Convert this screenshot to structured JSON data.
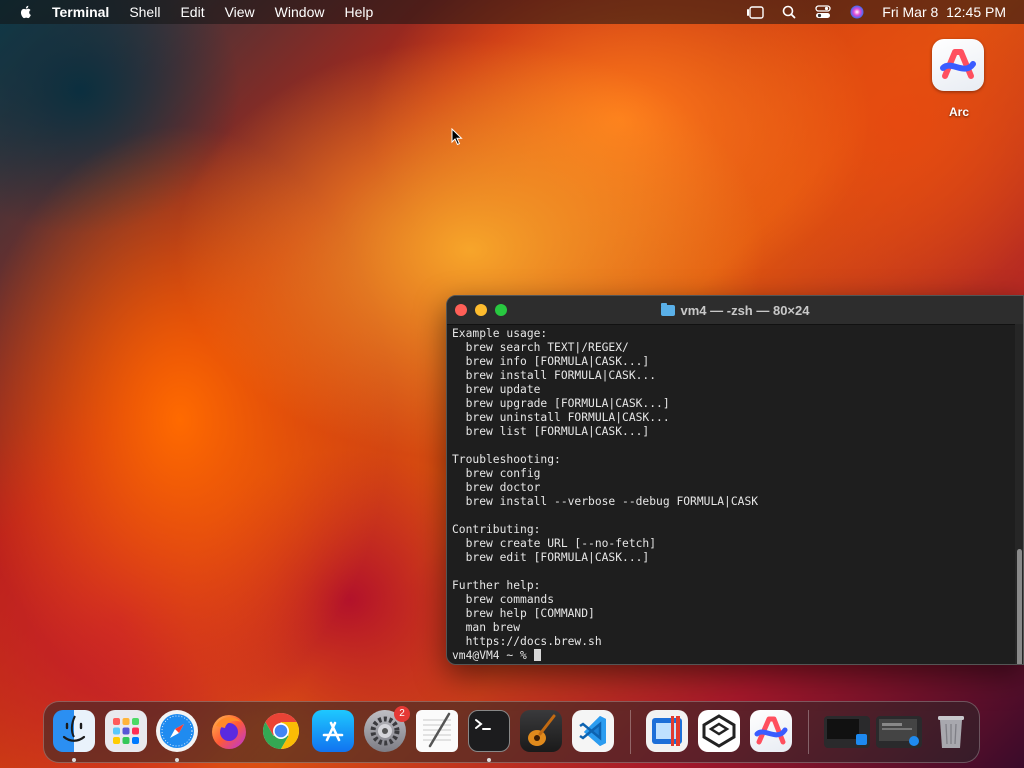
{
  "menubar": {
    "app_name": "Terminal",
    "items": [
      "Shell",
      "Edit",
      "View",
      "Window",
      "Help"
    ],
    "datetime": "Fri Mar 8  12:45 PM"
  },
  "desktop": {
    "icons": [
      {
        "label": "Arc",
        "icon": "arc-icon"
      }
    ]
  },
  "terminal": {
    "title": "vm4 — -zsh — 80×24",
    "lines": [
      "Example usage:",
      "  brew search TEXT|/REGEX/",
      "  brew info [FORMULA|CASK...]",
      "  brew install FORMULA|CASK...",
      "  brew update",
      "  brew upgrade [FORMULA|CASK...]",
      "  brew uninstall FORMULA|CASK...",
      "  brew list [FORMULA|CASK...]",
      "",
      "Troubleshooting:",
      "  brew config",
      "  brew doctor",
      "  brew install --verbose --debug FORMULA|CASK",
      "",
      "Contributing:",
      "  brew create URL [--no-fetch]",
      "  brew edit [FORMULA|CASK...]",
      "",
      "Further help:",
      "  brew commands",
      "  brew help [COMMAND]",
      "  man brew",
      "  https://docs.brew.sh"
    ],
    "prompt": "vm4@VM4 ~ % "
  },
  "dock": {
    "apps": [
      {
        "name": "finder-icon"
      },
      {
        "name": "launchpad-icon"
      },
      {
        "name": "safari-icon"
      },
      {
        "name": "firefox-icon"
      },
      {
        "name": "chrome-icon"
      },
      {
        "name": "app-store-icon"
      },
      {
        "name": "system-settings-icon",
        "badge": "2"
      },
      {
        "name": "textedit-icon"
      },
      {
        "name": "terminal-icon"
      },
      {
        "name": "garageband-icon"
      },
      {
        "name": "vscode-icon"
      },
      {
        "name": "parallels-icon"
      },
      {
        "name": "sketchup-icon"
      },
      {
        "name": "arc-icon"
      },
      {
        "name": "minimized-window-1"
      },
      {
        "name": "minimized-window-2"
      },
      {
        "name": "trash-icon"
      }
    ]
  }
}
